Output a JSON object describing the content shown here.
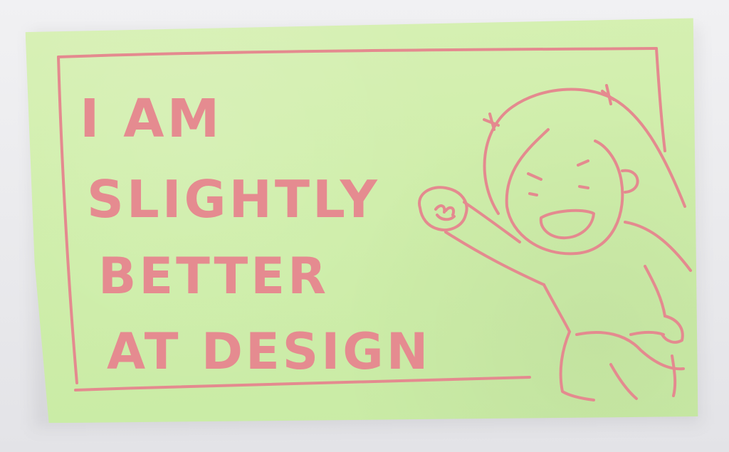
{
  "note": {
    "lines": [
      "I AM",
      "SLIGHTLY",
      "BETTER",
      "AT DESIGN"
    ]
  },
  "colors": {
    "paper": "#cfeeaa",
    "ink": "#e58b90",
    "background": "#ececef"
  }
}
